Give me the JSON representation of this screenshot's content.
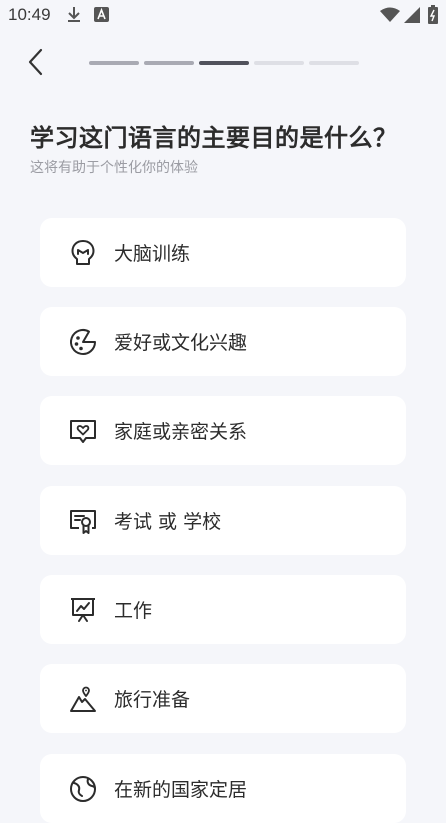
{
  "status_bar": {
    "time": "10:49",
    "icons": [
      "download-icon",
      "font-icon",
      "wifi-icon",
      "signal-icon",
      "battery-icon"
    ]
  },
  "header": {
    "back_icon": "chevron-left-icon",
    "progress": {
      "total_steps": 5,
      "current_step": 3
    }
  },
  "question": {
    "title": "学习这门语言的主要目的是什么？",
    "subtitle": "这将有助于个性化你的体验"
  },
  "options": [
    {
      "label": "大脑训练",
      "icon": "brain-icon"
    },
    {
      "label": "爱好或文化兴趣",
      "icon": "palette-icon"
    },
    {
      "label": "家庭或亲密关系",
      "icon": "heart-message-icon"
    },
    {
      "label": "考试 或 学校",
      "icon": "certificate-icon"
    },
    {
      "label": "工作",
      "icon": "presentation-chart-icon"
    },
    {
      "label": "旅行准备",
      "icon": "mountain-pin-icon"
    },
    {
      "label": "在新的国家定居",
      "icon": "globe-icon"
    }
  ],
  "colors": {
    "background": "#f5f6fa",
    "card": "#ffffff",
    "text": "#2c2c2c",
    "subtext": "#9b9ca3",
    "progress_current": "#51525c",
    "progress_done": "#a9aab3",
    "progress_todo": "#dedfe5"
  }
}
